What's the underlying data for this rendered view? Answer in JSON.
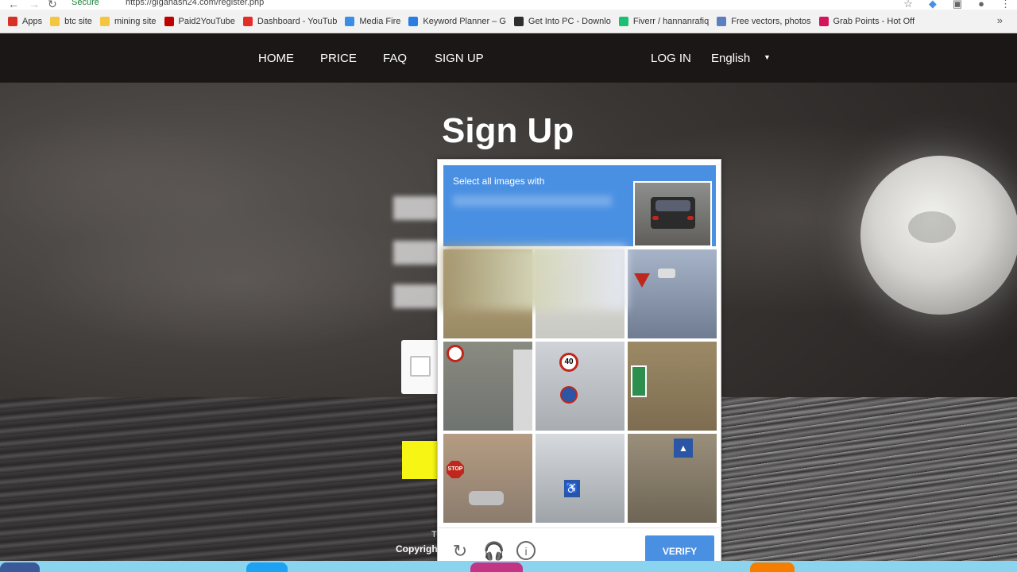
{
  "browser": {
    "secure_label": "Secure",
    "url": "https://gigahash24.com/register.php",
    "bookmarks": [
      {
        "label": "Apps",
        "color": "#d93025"
      },
      {
        "label": "btc site",
        "color": "#f4c542"
      },
      {
        "label": "mining site",
        "color": "#f4c542"
      },
      {
        "label": "Paid2YouTube",
        "color": "#c00000"
      },
      {
        "label": "Dashboard - YouTub",
        "color": "#e52d27"
      },
      {
        "label": "Media Fire",
        "color": "#3a8ee6"
      },
      {
        "label": "Keyword Planner – G",
        "color": "#2a7de1"
      },
      {
        "label": "Get Into PC - Downlo",
        "color": "#2d2d2d"
      },
      {
        "label": "Fiverr / hannanrafiq",
        "color": "#1dbf73"
      },
      {
        "label": "Free vectors, photos",
        "color": "#5b7fc0"
      },
      {
        "label": "Grab Points - Hot Off",
        "color": "#d4145a"
      }
    ]
  },
  "nav": {
    "home": "HOME",
    "price": "PRICE",
    "faq": "FAQ",
    "signup": "SIGN UP",
    "login": "LOG IN",
    "language": "English"
  },
  "page": {
    "title": "Sign Up",
    "copyright_prefix": "Copyright",
    "footer_t": "T"
  },
  "captcha": {
    "prompt": "Select all images with",
    "verify_label": "VERIFY",
    "icons": [
      "refresh-icon",
      "headphones-icon",
      "info-icon"
    ]
  }
}
